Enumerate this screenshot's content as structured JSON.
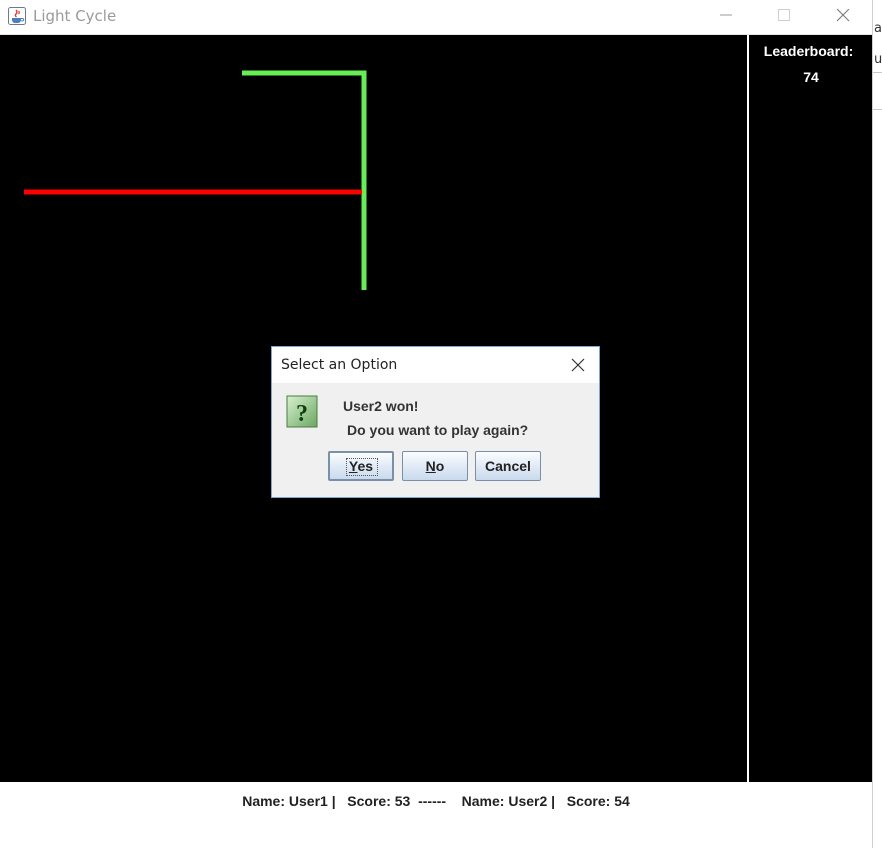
{
  "window": {
    "title": "Light Cycle",
    "controls": [
      "minimize-icon",
      "maximize-icon",
      "close-icon"
    ]
  },
  "background_window": {
    "fragments": [
      "ac",
      "u"
    ]
  },
  "game": {
    "background": "#000000",
    "trails": [
      {
        "player": "User1",
        "color": "#ff0000",
        "icon": "red-light-cycle-trail"
      },
      {
        "player": "User2",
        "color": "#66ee55",
        "icon": "green-light-cycle-trail"
      }
    ]
  },
  "leaderboard": {
    "title": "Leaderboard:",
    "top_score": "74"
  },
  "status": {
    "name1_label": "Name: User1 |",
    "score1_label": "Score: 53",
    "separator": "------",
    "name2_label": "Name: User2 |",
    "score2_label": "Score: 54"
  },
  "dialog": {
    "title": "Select an Option",
    "icon": "question-icon",
    "message_line1": "User2 won!",
    "message_line2": "Do you want to play again?",
    "buttons": {
      "yes": {
        "mnemonic": "Y",
        "rest": "es"
      },
      "no": {
        "mnemonic": "N",
        "rest": "o"
      },
      "cancel": "Cancel"
    },
    "accent": "#7fa7d4"
  }
}
